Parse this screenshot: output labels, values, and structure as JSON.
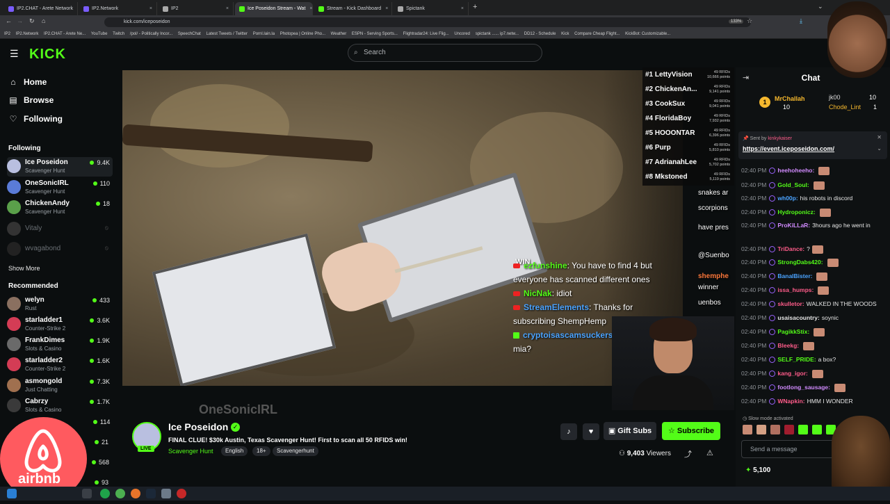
{
  "browser": {
    "tabs": [
      {
        "label": "IP2.CHAT - Arete Network",
        "color": "#7a5cff"
      },
      {
        "label": "IP2.Network",
        "color": "#7a5cff"
      },
      {
        "label": "IP2",
        "color": "#aaaaaa"
      },
      {
        "label": "Ice Poseidon Stream - Wat",
        "color": "#53fc18"
      },
      {
        "label": "Stream - Kick Dashboard",
        "color": "#53fc18"
      },
      {
        "label": "Spictank",
        "color": "#aaaaaa"
      }
    ],
    "url": "kick.com/iceposeidon",
    "zoom": "133%",
    "bookmarks": [
      "IP2",
      "IP2.Network",
      "IP2.CHAT - Arete Ne...",
      "YouTube",
      "Twitch",
      "/pol/ - Politically Incor...",
      "SpeechChat",
      "Latest Tweets / Twitter",
      "Pornl.lain.la",
      "Photopea | Online Pho...",
      "Weather",
      "ESPN - Serving Sports...",
      "Flightradar24: Live Flig...",
      "Uncored",
      "spictank ...... ip7.netw...",
      "DD12 - Schedule",
      "Kick",
      "Compare Cheap Flight...",
      "KickBot: Customizable..."
    ]
  },
  "header": {
    "logo": "KICK",
    "search_placeholder": "Search"
  },
  "sidebar": {
    "nav": [
      {
        "label": "Home",
        "icon": "home-icon"
      },
      {
        "label": "Browse",
        "icon": "browse-icon"
      },
      {
        "label": "Following",
        "icon": "heart-icon"
      }
    ],
    "following_title": "Following",
    "following": [
      {
        "name": "Ice Poseidon",
        "category": "Scavenger Hunt",
        "viewers": "9.4K",
        "color": "#b9bfe0",
        "live": true
      },
      {
        "name": "OneSonicIRL",
        "category": "Scavenger Hunt",
        "viewers": "110",
        "color": "#5a7bd8",
        "live": true
      },
      {
        "name": "ChickenAndy",
        "category": "Scavenger Hunt",
        "viewers": "18",
        "color": "#5aa04a",
        "live": true
      },
      {
        "name": "Vitaly",
        "category": "",
        "viewers": "",
        "color": "#444444",
        "live": false
      },
      {
        "name": "wvagabond",
        "category": "",
        "viewers": "",
        "color": "#444444",
        "live": false
      }
    ],
    "show_more": "Show More",
    "recommended_title": "Recommended",
    "recommended": [
      {
        "name": "welyn",
        "category": "Rust",
        "viewers": "433",
        "color": "#8a7060"
      },
      {
        "name": "starladder1",
        "category": "Counter-Strike 2",
        "viewers": "3.6K",
        "color": "#d43c55"
      },
      {
        "name": "FrankDimes",
        "category": "Slots & Casino",
        "viewers": "1.9K",
        "color": "#6a6a6a"
      },
      {
        "name": "starladder2",
        "category": "Counter-Strike 2",
        "viewers": "1.6K",
        "color": "#d43c55"
      },
      {
        "name": "asmongold",
        "category": "Just Chatting",
        "viewers": "7.3K",
        "color": "#a0704f"
      },
      {
        "name": "Cabrzy",
        "category": "Slots & Casino",
        "viewers": "1.7K",
        "color": "#3a3a3a"
      }
    ],
    "more_counts": [
      "114",
      "21",
      "568",
      "93"
    ]
  },
  "leaderboard": [
    {
      "rank": "#1 LettyVision",
      "rfids": "49 RFIDs",
      "points": "10,666 points"
    },
    {
      "rank": "#2 ChickenAn...",
      "rfids": "49 RFIDs",
      "points": "9,141 points"
    },
    {
      "rank": "#3 CookSux",
      "rfids": "49 RFIDs",
      "points": "9,041 points"
    },
    {
      "rank": "#4 FloridaBoy",
      "rfids": "49 RFIDs",
      "points": "7,932 points"
    },
    {
      "rank": "#5 HOOONTAR",
      "rfids": "49 RFIDs",
      "points": "6,396 points"
    },
    {
      "rank": "#6 Purp",
      "rfids": "49 RFIDs",
      "points": "5,810 points"
    },
    {
      "rank": "#7 AdrianahLee",
      "rfids": "49 RFIDs",
      "points": "5,702 points"
    },
    {
      "rank": "#8 Mkstoned",
      "rfids": "49 RFIDs",
      "points": "5,119 points"
    }
  ],
  "overlay_chat": [
    {
      "platform": "yt",
      "user": "ezfunshine",
      "text": ": You have to find 4 but everyone has scanned different ones",
      "color": "#53fc18"
    },
    {
      "platform": "yt",
      "user": "NicNak",
      "text": ": idiot",
      "color": "#53fc18"
    },
    {
      "platform": "yt",
      "user": "StreamElements",
      "text": ": Thanks for subscribing ShempHemp",
      "color": "#4aa3ff"
    },
    {
      "platform": "kick",
      "user": "cryptoisascamsuckers",
      "text": ": benny mia?",
      "color": "#4aa3ff"
    }
  ],
  "overlay_side": [
    "snakes ar",
    "scorpions",
    "have pres",
    "@Suenbo",
    "shemphe",
    "winner",
    "uenbos"
  ],
  "overlay_top_text": "WIN",
  "overlay_bg_name": "OneSonicIRL",
  "stream": {
    "name": "Ice Poseidon",
    "title": "FINAL CLUE! $30k Austin, Texas Scavenger Hunt! First to scan all 50 RFIDS win!",
    "category": "Scavenger Hunt",
    "tags": [
      "English",
      "18+",
      "Scavengerhunt"
    ],
    "live_label": "LIVE",
    "viewers": "9,403",
    "viewers_label": "Viewers",
    "gift_label": "Gift Subs",
    "subscribe_label": "Subscribe"
  },
  "chat": {
    "title": "Chat",
    "gifters": [
      {
        "name": "MrChallah",
        "count": "10",
        "rank": "1"
      },
      {
        "name": "jk00",
        "count": "10"
      },
      {
        "name": "Chode_Lint",
        "count": "1"
      }
    ],
    "pinned_sender_label": "Sent by",
    "pinned_sender": "kinkykaiser",
    "pinned_link": "https://event.iceposeidon.com/",
    "messages": [
      {
        "time": "02:40 PM",
        "user": "heehoheeho:",
        "text": "",
        "color": "#d18bff",
        "emote": true
      },
      {
        "time": "02:40 PM",
        "user": "Gold_Soul:",
        "text": "",
        "color": "#53fc18",
        "emote": true
      },
      {
        "time": "02:40 PM",
        "user": "wh00p:",
        "text": "his robots in discord",
        "color": "#4aa3ff",
        "emote": false
      },
      {
        "time": "02:40 PM",
        "user": "Hydroponicz:",
        "text": "",
        "color": "#53fc18",
        "emote": true
      },
      {
        "time": "02:40 PM",
        "user": "ProKiLLaR:",
        "text": "3hours ago he went in",
        "color": "#d18bff",
        "emote": false
      },
      {
        "time": "02:40 PM",
        "user": "TriDance:",
        "text": "?",
        "color": "#ff5c8a",
        "emote": true
      },
      {
        "time": "02:40 PM",
        "user": "StrongDabs420:",
        "text": "",
        "color": "#53fc18",
        "emote": true
      },
      {
        "time": "02:40 PM",
        "user": "BanalBister:",
        "text": "",
        "color": "#4aa3ff",
        "emote": true
      },
      {
        "time": "02:40 PM",
        "user": "issa_humps:",
        "text": "",
        "color": "#ff5c8a",
        "emote": true
      },
      {
        "time": "02:40 PM",
        "user": "skulletor:",
        "text": "WALKED IN THE WOODS",
        "color": "#ff5c8a",
        "emote": false
      },
      {
        "time": "02:40 PM",
        "user": "usaisacountry:",
        "text": "soynic",
        "color": "#e6e6e6",
        "emote": false
      },
      {
        "time": "02:40 PM",
        "user": "PagikkStix:",
        "text": "",
        "color": "#53fc18",
        "emote": true
      },
      {
        "time": "02:40 PM",
        "user": "Bleekg:",
        "text": "",
        "color": "#ff5c8a",
        "emote": true
      },
      {
        "time": "02:40 PM",
        "user": "SELF_PRIDE:",
        "text": "a box?",
        "color": "#53fc18",
        "emote": false
      },
      {
        "time": "02:40 PM",
        "user": "kang_igor:",
        "text": "",
        "color": "#ff5c8a",
        "emote": true
      },
      {
        "time": "02:40 PM",
        "user": "footlong_sausage:",
        "text": "",
        "color": "#d18bff",
        "emote": true
      },
      {
        "time": "02:40 PM",
        "user": "WNapkin:",
        "text": "HMM I WONDER",
        "color": "#ff5c8a",
        "emote": false
      }
    ],
    "slow_mode": "Slow mode activated",
    "send_placeholder": "Send a message",
    "points": "5,100"
  },
  "overlays": {
    "airbnb": "airbnb"
  }
}
